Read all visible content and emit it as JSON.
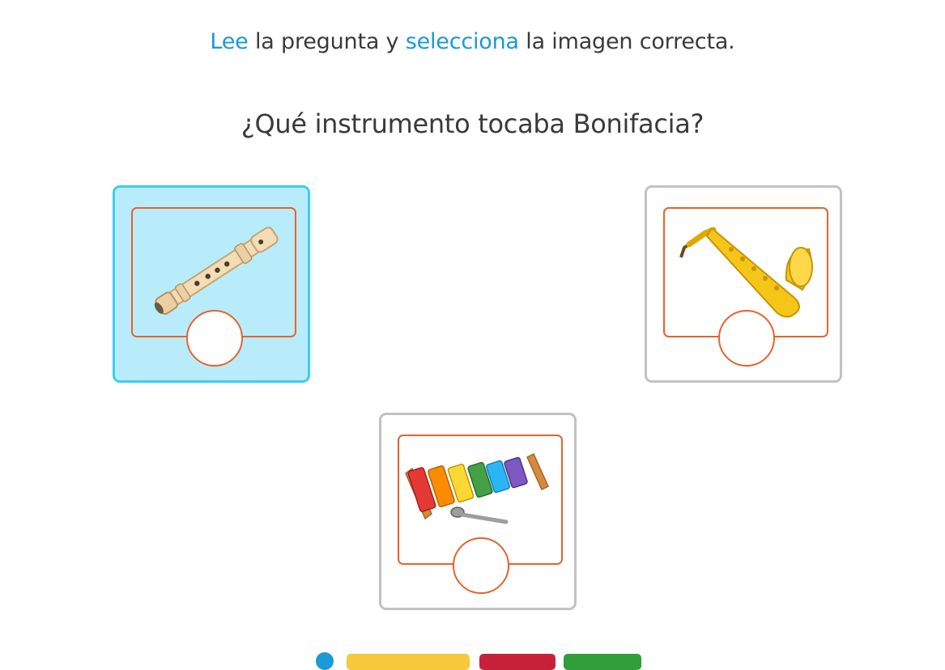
{
  "instruction": {
    "word1": "Lee",
    "part1": " la pregunta y ",
    "word2": "selecciona",
    "part2": " la imagen correcta."
  },
  "question": "¿Qué instrumento tocaba Bonifacia?",
  "options": [
    {
      "name": "flute",
      "selected": true
    },
    {
      "name": "saxophone",
      "selected": false
    },
    {
      "name": "xylophone",
      "selected": false
    }
  ],
  "colors": {
    "accent": "#1a9ad6",
    "selected_bg": "#b9ecfb",
    "selected_border": "#3ccfec",
    "frame": "#e8622c",
    "card_border": "#c2c2c2"
  }
}
